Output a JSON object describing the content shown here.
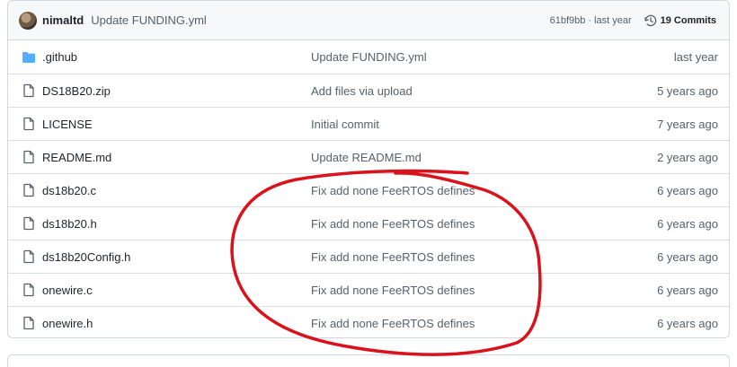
{
  "header": {
    "author": "nimaltd",
    "commit_message": "Update FUNDING.yml",
    "sha": "61bf9bb",
    "separator": "·",
    "time": "last year",
    "commits_label": "19 Commits"
  },
  "files": [
    {
      "name": ".github",
      "type": "folder",
      "message": "Update FUNDING.yml",
      "age": "last year"
    },
    {
      "name": "DS18B20.zip",
      "type": "file",
      "message": "Add files via upload",
      "age": "5 years ago"
    },
    {
      "name": "LICENSE",
      "type": "file",
      "message": "Initial commit",
      "age": "7 years ago"
    },
    {
      "name": "README.md",
      "type": "file",
      "message": "Update README.md",
      "age": "2 years ago"
    },
    {
      "name": "ds18b20.c",
      "type": "file",
      "message": "Fix add none FeeRTOS defines",
      "age": "6 years ago"
    },
    {
      "name": "ds18b20.h",
      "type": "file",
      "message": "Fix add none FeeRTOS defines",
      "age": "6 years ago"
    },
    {
      "name": "ds18b20Config.h",
      "type": "file",
      "message": "Fix add none FeeRTOS defines",
      "age": "6 years ago"
    },
    {
      "name": "onewire.c",
      "type": "file",
      "message": "Fix add none FeeRTOS defines",
      "age": "6 years ago"
    },
    {
      "name": "onewire.h",
      "type": "file",
      "message": "Fix add none FeeRTOS defines",
      "age": "6 years ago"
    }
  ],
  "colors": {
    "folder_icon": "#54aeff",
    "annotation": "#d9121b"
  }
}
